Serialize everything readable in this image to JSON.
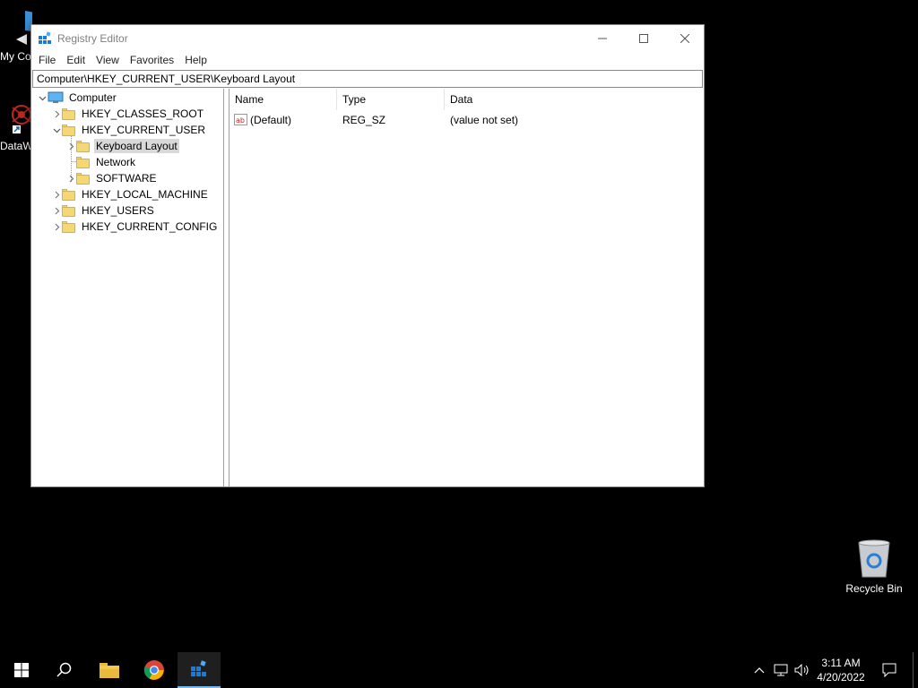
{
  "desktop": {
    "icons": [
      {
        "label": "My Computer"
      },
      {
        "label": "DataWin"
      },
      {
        "label": "Recycle Bin"
      }
    ]
  },
  "window": {
    "title": "Registry Editor",
    "menu": [
      "File",
      "Edit",
      "View",
      "Favorites",
      "Help"
    ],
    "address": "Computer\\HKEY_CURRENT_USER\\Keyboard Layout",
    "tree": {
      "root": "Computer",
      "nodes": [
        {
          "label": "HKEY_CLASSES_ROOT"
        },
        {
          "label": "HKEY_CURRENT_USER"
        },
        {
          "label": "Keyboard Layout"
        },
        {
          "label": "Network"
        },
        {
          "label": "SOFTWARE"
        },
        {
          "label": "HKEY_LOCAL_MACHINE"
        },
        {
          "label": "HKEY_USERS"
        },
        {
          "label": "HKEY_CURRENT_CONFIG"
        }
      ]
    },
    "list": {
      "columns": [
        "Name",
        "Type",
        "Data"
      ],
      "rows": [
        {
          "name": "(Default)",
          "type": "REG_SZ",
          "data": "(value not set)"
        }
      ]
    }
  },
  "taskbar": {
    "clock_time": "3:11 AM",
    "clock_date": "4/20/2022"
  },
  "colors": {
    "folder": "#f6d775",
    "taskbar_active": "#76b9ed"
  }
}
